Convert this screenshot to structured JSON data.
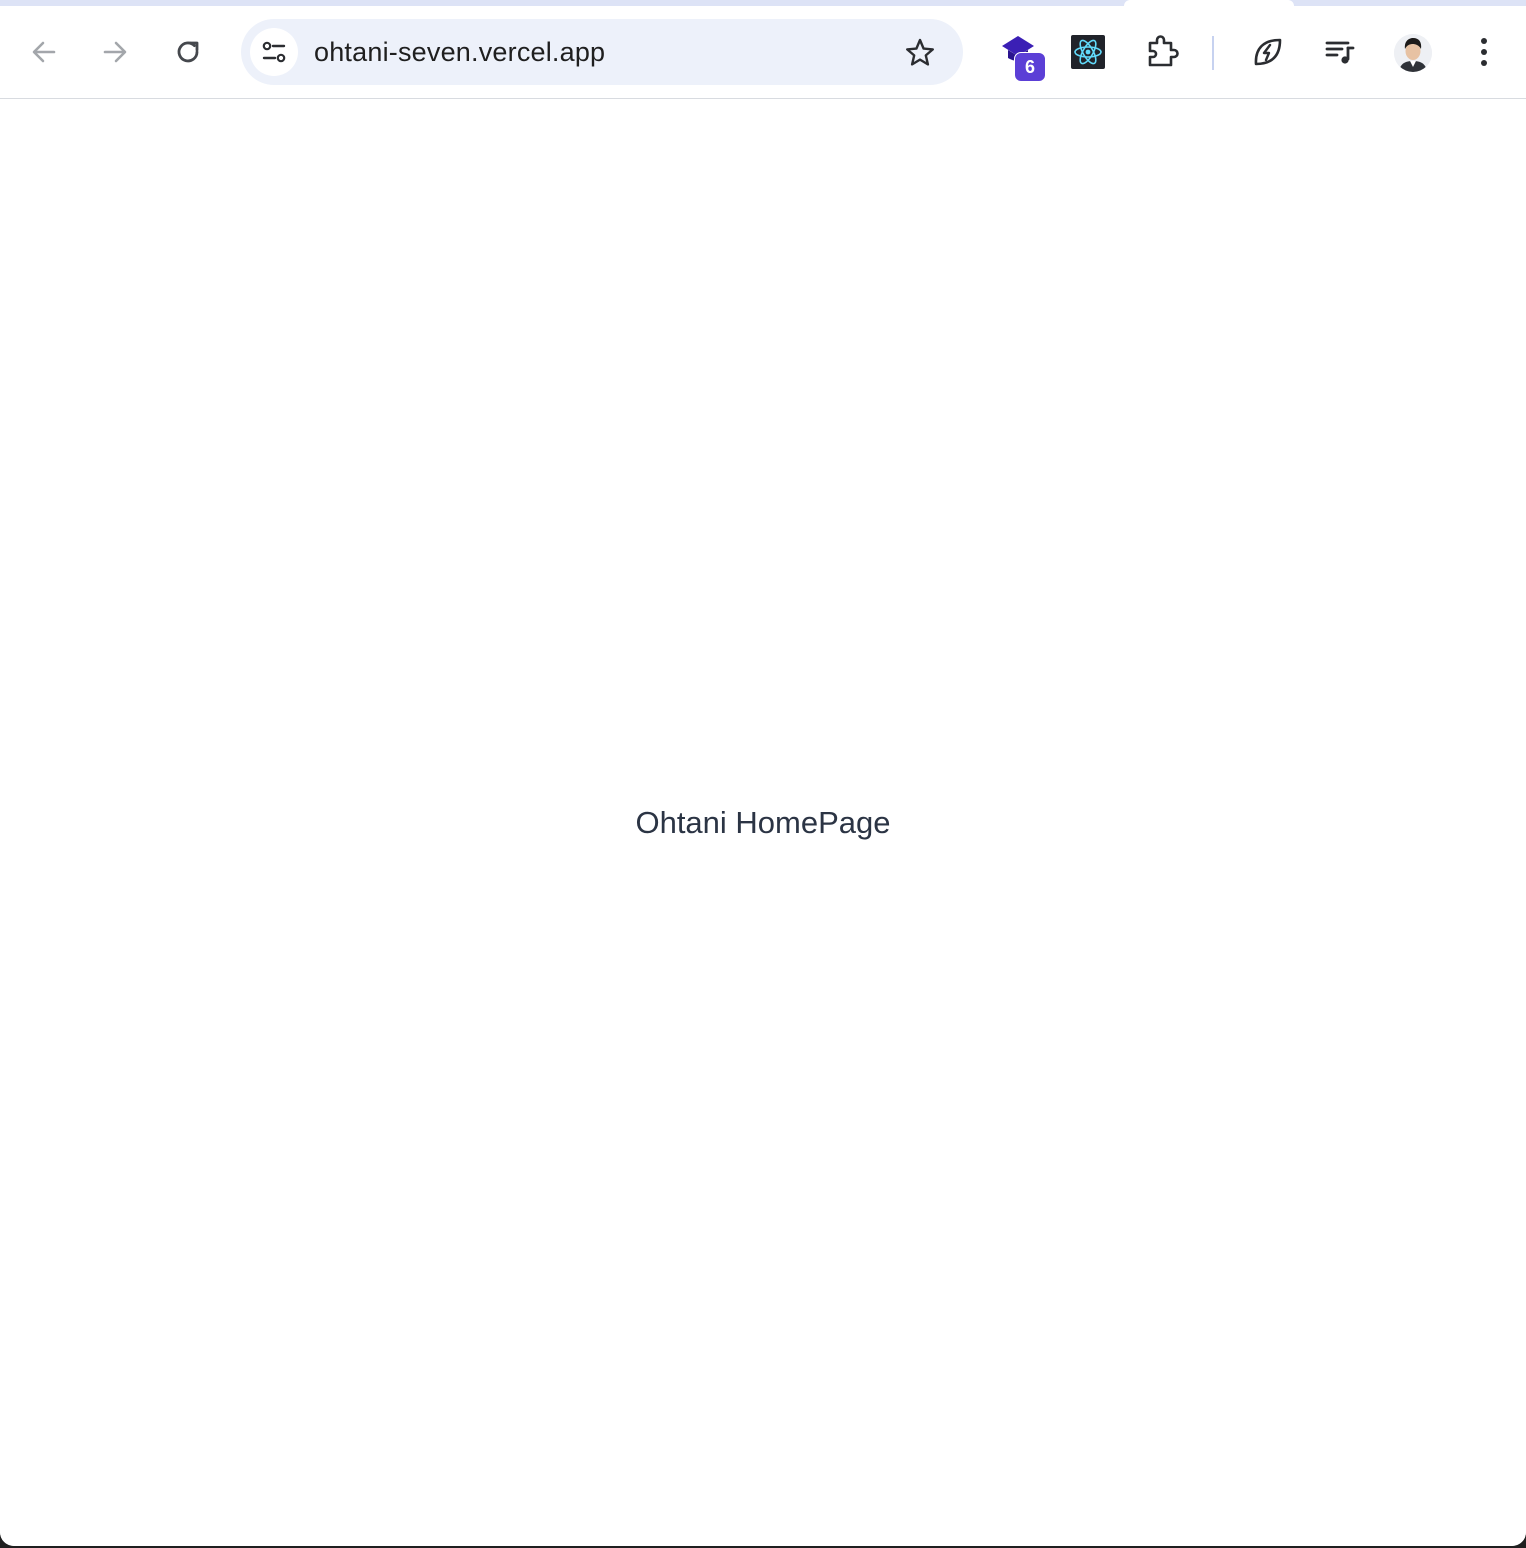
{
  "browser": {
    "omnibox": {
      "url": "ohtani-seven.vercel.app"
    },
    "extensions": [
      {
        "icon": "graduation-cap-icon",
        "badge": "6"
      },
      {
        "icon": "react-atom-icon"
      },
      {
        "icon": "puzzle-extensions-icon"
      },
      {
        "icon": "bolt-leaf-icon"
      },
      {
        "icon": "playlist-music-icon"
      }
    ],
    "colors": {
      "tabstrip": "#dde3f6",
      "omnibox_bg": "#edf1fa",
      "badge": "#5b3fd6"
    }
  },
  "page": {
    "heading": "Ohtani HomePage"
  }
}
